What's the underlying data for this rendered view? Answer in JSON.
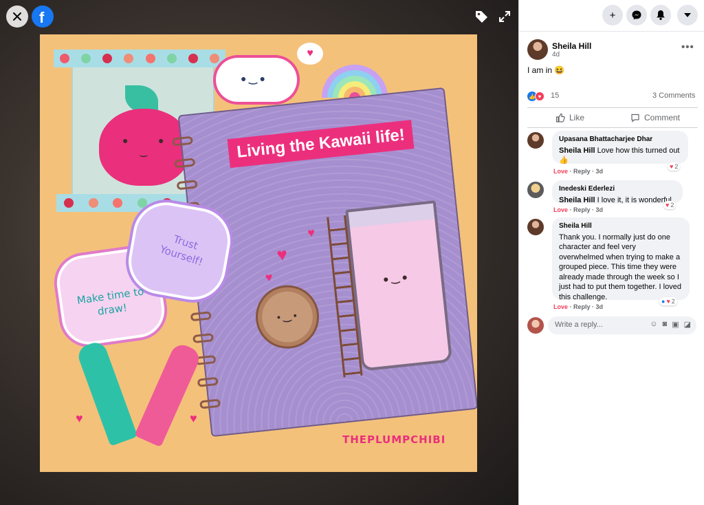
{
  "viewer": {
    "icons": {
      "close": "close-icon",
      "brand": "facebook-logo",
      "tag": "tag-icon",
      "expand": "expand-icon"
    },
    "photo": {
      "notebook_title": "Living the Kawaii life!",
      "note_make_time": "Make time to draw!",
      "note_trust": "Trust Yourself!",
      "watermark": "THEPLUMPCHIBI"
    }
  },
  "topbar": {
    "buttons": [
      {
        "name": "create",
        "icon": "plus-icon",
        "glyph": "+"
      },
      {
        "name": "messenger",
        "icon": "messenger-icon",
        "glyph": "✉"
      },
      {
        "name": "notifications",
        "icon": "bell-icon",
        "glyph": "🔔"
      },
      {
        "name": "account",
        "icon": "caret-down-icon",
        "glyph": "▾"
      }
    ]
  },
  "post": {
    "author": "Sheila Hill",
    "time": "4d",
    "text": "I am in 😆",
    "reaction_count": "15",
    "comment_count": "3 Comments",
    "actions": {
      "like": "Like",
      "comment": "Comment"
    }
  },
  "comments": [
    {
      "author": "Upasana Bhattacharjee Dhar",
      "mention": "Sheila Hill",
      "text": " Love how this turned out 👍",
      "meta": {
        "love": "Love",
        "reply": "Reply",
        "time": "3d"
      },
      "reactions": "2"
    },
    {
      "author": "Inedeski Ederlezi",
      "mention": "Sheila Hill",
      "text": " I love it, it is wonderful.",
      "meta": {
        "love": "Love",
        "reply": "Reply",
        "time": "3d"
      },
      "reactions": "2"
    },
    {
      "author": "Sheila Hill",
      "mention": "",
      "text": "Thank you. I normally just do one character and feel very overwhelmed when trying to make a grouped piece. This time they were already made through the week so I just had to put them together. I loved this challenge.",
      "meta": {
        "love": "Love",
        "reply": "Reply",
        "time": "3d"
      },
      "reactions": "2"
    }
  ],
  "reply": {
    "placeholder": "Write a reply..."
  },
  "colors": {
    "brand": "#1877f2",
    "love": "#f33e58",
    "bubble": "#f0f2f5",
    "photo_bg": "#f4c17a"
  }
}
